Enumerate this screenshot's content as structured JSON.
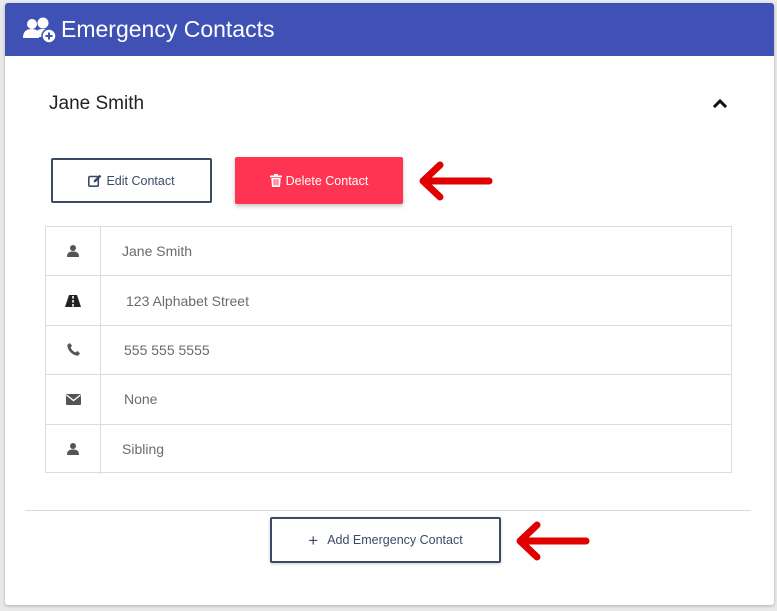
{
  "header": {
    "title": "Emergency Contacts",
    "icon": "user-group-add-icon",
    "background": "#3f51b5"
  },
  "contact": {
    "name": "Jane Smith",
    "expand_icon": "chevron-up-icon"
  },
  "actions": {
    "edit_label": "Edit Contact",
    "edit_icon": "edit-icon",
    "delete_label": "Delete Contact",
    "delete_icon": "trash-icon",
    "delete_color": "#ff3352"
  },
  "details": [
    {
      "icon": "user-icon",
      "value": "Jane Smith"
    },
    {
      "icon": "road-icon",
      "value": "123 Alphabet Street"
    },
    {
      "icon": "phone-icon",
      "value": "555 555 5555"
    },
    {
      "icon": "envelope-icon",
      "value": "None"
    },
    {
      "icon": "user-icon",
      "value": "Sibling"
    }
  ],
  "add": {
    "label": "Add Emergency Contact",
    "icon": "plus-icon"
  },
  "annotations": {
    "arrow_color": "#e00000"
  }
}
